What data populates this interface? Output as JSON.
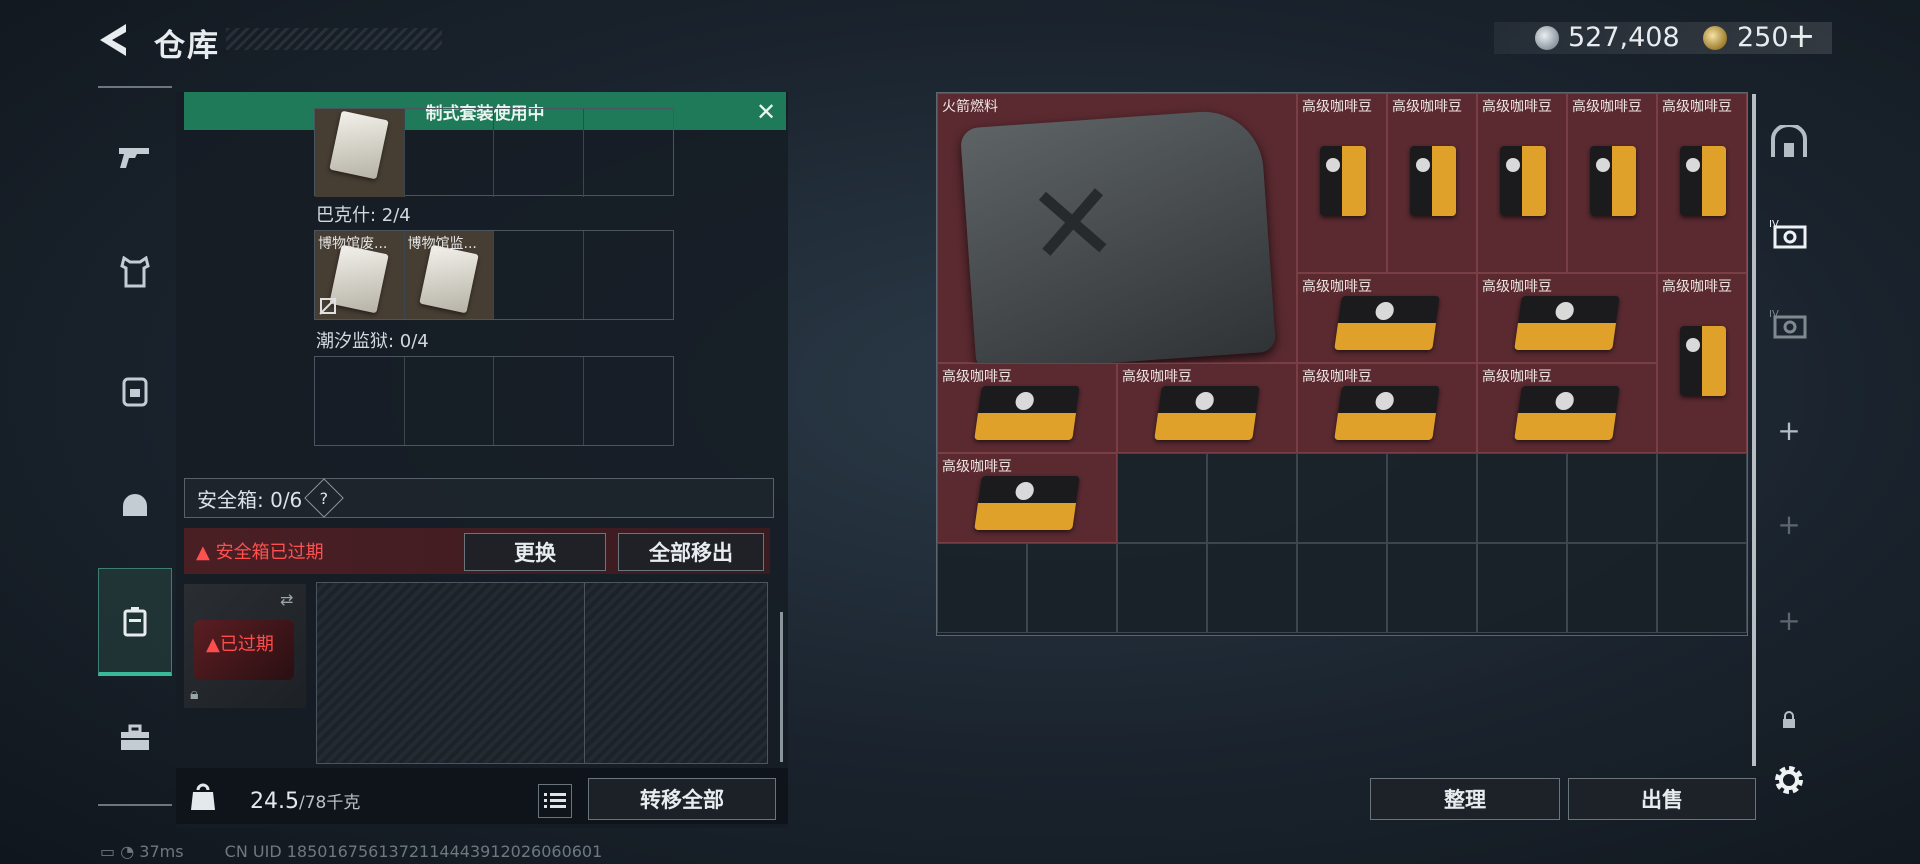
{
  "header": {
    "title": "仓库"
  },
  "currency": {
    "coins": "527,408",
    "bonds": "250",
    "plus": "+"
  },
  "loadout": {
    "banner": "制式套装使用中",
    "sections": [
      {
        "label": "巴克什: 2/4",
        "items": [
          "博物馆废...",
          "博物馆监..."
        ]
      },
      {
        "label": "潮汐监狱: 0/4",
        "items": []
      }
    ]
  },
  "safe": {
    "label": "安全箱: 0/6",
    "help": "?",
    "expired_msg": "安全箱已过期",
    "replace_btn": "更换",
    "move_all_btn": "全部移出",
    "expired_badge": "已过期"
  },
  "weight": {
    "value": "24.5",
    "unit": "/78千克"
  },
  "transfer_all": "转移全部",
  "storage": {
    "items": [
      {
        "name": "火箭燃料"
      },
      {
        "name": "高级咖啡豆"
      }
    ],
    "sort_btn": "整理",
    "sell_btn": "出售"
  },
  "status": {
    "ping": "37ms",
    "uid": "CN UID 1850167561372114443912026060601"
  }
}
